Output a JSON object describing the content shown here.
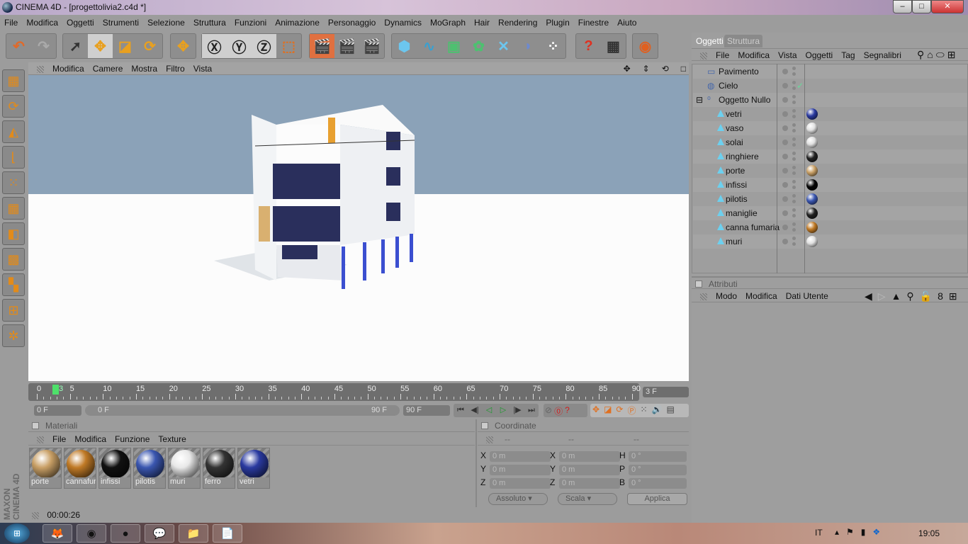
{
  "window": {
    "title": "CINEMA 4D - [progettolivia2.c4d *]",
    "controls": [
      "–",
      "□",
      "✕"
    ]
  },
  "menu": [
    "File",
    "Modifica",
    "Oggetti",
    "Strumenti",
    "Selezione",
    "Struttura",
    "Funzioni",
    "Animazione",
    "Personaggio",
    "Dynamics",
    "MoGraph",
    "Hair",
    "Rendering",
    "Plugin",
    "Finestre",
    "Aiuto"
  ],
  "toolbar": {
    "groups": [
      [
        {
          "icon": "undo-icon",
          "g": "↶",
          "c": "#e06a2a"
        },
        {
          "icon": "redo-icon",
          "g": "↷",
          "c": "#aaa"
        }
      ],
      [
        {
          "icon": "select-arrow-icon",
          "g": "➚",
          "c": "#333"
        },
        {
          "icon": "move-icon",
          "g": "✥",
          "c": "#e8a020",
          "sel": true
        },
        {
          "icon": "scale-icon",
          "g": "◪",
          "c": "#e8a020"
        },
        {
          "icon": "rotate-icon",
          "g": "⟳",
          "c": "#e8a020"
        }
      ],
      [
        {
          "icon": "live-move-icon",
          "g": "✥",
          "c": "#e8a020"
        }
      ],
      [
        {
          "icon": "x-axis-icon",
          "g": "Ⓧ",
          "c": "#222",
          "sel": true
        },
        {
          "icon": "y-axis-icon",
          "g": "Ⓨ",
          "c": "#222",
          "sel": true
        },
        {
          "icon": "z-axis-icon",
          "g": "Ⓩ",
          "c": "#222",
          "sel": true
        },
        {
          "icon": "coordinate-system-icon",
          "g": "⬚",
          "c": "#e07020"
        }
      ],
      [
        {
          "icon": "render-view-icon",
          "g": "🎬",
          "c": "#222",
          "act": true
        },
        {
          "icon": "render-picture-viewer-icon",
          "g": "🎬",
          "c": "#222"
        },
        {
          "icon": "render-settings-icon",
          "g": "🎬",
          "c": "#222"
        }
      ],
      [
        {
          "icon": "cube-icon",
          "g": "⬢",
          "c": "#6cc6ee"
        },
        {
          "icon": "spline-pen-icon",
          "g": "∿",
          "c": "#3aa0d0"
        },
        {
          "icon": "subdivision-icon",
          "g": "▣",
          "c": "#4ec070"
        },
        {
          "icon": "array-icon",
          "g": "✿",
          "c": "#4ec070"
        },
        {
          "icon": "deformer-icon",
          "g": "✕",
          "c": "#6cc6ee"
        },
        {
          "icon": "environment-icon",
          "g": "◗",
          "c": "#6d8ad0"
        },
        {
          "icon": "particles-icon",
          "g": "⁘",
          "c": "#fff"
        }
      ],
      [
        {
          "icon": "help-icon",
          "g": "?",
          "c": "#e03020"
        },
        {
          "icon": "calculator-icon",
          "g": "▦",
          "c": "#333"
        }
      ],
      [
        {
          "icon": "web-icon",
          "g": "◉",
          "c": "#e06020"
        }
      ]
    ]
  },
  "leftbar": [
    {
      "icon": "layout-icon",
      "g": "▦"
    },
    {
      "icon": "make-editable-icon",
      "g": "⟳"
    },
    {
      "icon": "model-mode-icon",
      "g": "◭"
    },
    {
      "icon": "object-axis-icon",
      "g": "⌊"
    },
    {
      "icon": "points-mode-icon",
      "g": "⁙"
    },
    {
      "icon": "edges-mode-icon",
      "g": "▦"
    },
    {
      "icon": "polygons-mode-icon",
      "g": "◧"
    },
    {
      "icon": "texture-mode-icon",
      "g": "▩"
    },
    {
      "icon": "uv-mode-icon",
      "g": "▚"
    },
    {
      "icon": "workplane-icon",
      "g": "⊞"
    },
    {
      "icon": "sculpt-icon",
      "g": "✲"
    }
  ],
  "viewport": {
    "menu": [
      "Modifica",
      "Camere",
      "Mostra",
      "Filtro",
      "Vista"
    ],
    "controls": [
      "✥",
      "⇕",
      "⟲",
      "□"
    ],
    "sky_color": "#8ba2b8"
  },
  "timeline": {
    "ticks": [
      "0",
      "5",
      "10",
      "15",
      "20",
      "25",
      "30",
      "35",
      "40",
      "45",
      "50",
      "55",
      "60",
      "65",
      "70",
      "75",
      "80",
      "85",
      "90"
    ],
    "current": "3",
    "current_frame_field": "3 F",
    "start": "0 F",
    "range_start": "0 F",
    "range_end": "90 F",
    "end": "90 F",
    "playback": [
      "⏮",
      "◀|",
      "◁",
      "▷",
      "|▶",
      "⏭"
    ]
  },
  "materials": {
    "title": "Materiali",
    "menu": [
      "File",
      "Modifica",
      "Funzione",
      "Texture"
    ],
    "items": [
      {
        "name": "porte",
        "color": "#c9a066"
      },
      {
        "name": "cannafur",
        "color": "#c07a26"
      },
      {
        "name": "infissi",
        "color": "#111"
      },
      {
        "name": "pilotis",
        "color": "#3a56b0"
      },
      {
        "name": "muri",
        "color": "#e8e8e8"
      },
      {
        "name": "ferro",
        "color": "#333"
      },
      {
        "name": "vetri",
        "color": "#2a3aa0"
      }
    ]
  },
  "coordinates": {
    "title": "Coordinate",
    "headers": [
      "--",
      "--",
      "--"
    ],
    "rows": [
      {
        "a": "X",
        "av": "0 m",
        "b": "X",
        "bv": "0 m",
        "c": "H",
        "cv": "0 °"
      },
      {
        "a": "Y",
        "av": "0 m",
        "b": "Y",
        "bv": "0 m",
        "c": "P",
        "cv": "0 °"
      },
      {
        "a": "Z",
        "av": "0 m",
        "b": "Z",
        "bv": "0 m",
        "c": "B",
        "cv": "0 °"
      }
    ],
    "mode": "Assoluto",
    "scale": "Scala",
    "apply": "Applica"
  },
  "status": {
    "time": "00:00:26"
  },
  "brand": "MAXON CINEMA 4D",
  "objects": {
    "tabs": [
      "Oggetti",
      "Struttura"
    ],
    "menu": [
      "File",
      "Modifica",
      "Vista",
      "Oggetti",
      "Tag",
      "Segnalibri"
    ],
    "items": [
      {
        "name": "Pavimento",
        "level": 0,
        "icon": "floor-icon"
      },
      {
        "name": "Cielo",
        "level": 0,
        "icon": "sky-icon",
        "check": "✓"
      },
      {
        "name": "Oggetto Nullo",
        "level": 0,
        "icon": "null-object-icon",
        "expand": "⊟"
      },
      {
        "name": "vetri",
        "level": 1,
        "tag": "#2a3aa0"
      },
      {
        "name": "vaso",
        "level": 1,
        "tag": "#e0e0e0"
      },
      {
        "name": "solai",
        "level": 1,
        "tag": "#e0e0e0"
      },
      {
        "name": "ringhiere",
        "level": 1,
        "tag": "#222"
      },
      {
        "name": "porte",
        "level": 1,
        "tag": "#c9a066"
      },
      {
        "name": "infissi",
        "level": 1,
        "tag": "#050505"
      },
      {
        "name": "pilotis",
        "level": 1,
        "tag": "#3a56b0"
      },
      {
        "name": "maniglie",
        "level": 1,
        "tag": "#222"
      },
      {
        "name": "canna fumaria",
        "level": 1,
        "tag": "#c07a26"
      },
      {
        "name": "muri",
        "level": 1,
        "tag": "#e0e0e0"
      }
    ]
  },
  "attributes": {
    "title": "Attributi",
    "menu": [
      "Modo",
      "Modifica",
      "Dati Utente"
    ]
  },
  "taskbar": {
    "apps": [
      {
        "icon": "firefox-icon",
        "g": "🦊"
      },
      {
        "icon": "chrome-icon",
        "g": "◉"
      },
      {
        "icon": "cinema4d-icon",
        "g": "●"
      },
      {
        "icon": "chat-icon",
        "g": "💬"
      },
      {
        "icon": "explorer-icon",
        "g": "📁"
      },
      {
        "icon": "document-icon",
        "g": "📄"
      }
    ],
    "lang": "IT",
    "clock": "19:05"
  }
}
